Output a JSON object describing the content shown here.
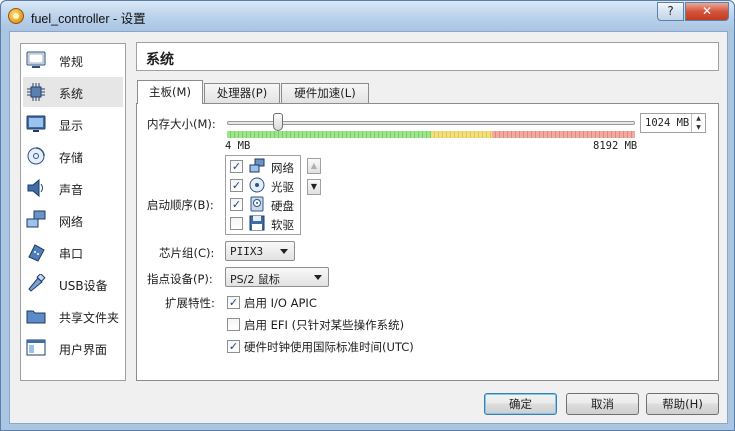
{
  "window": {
    "title": "fuel_controller - 设置",
    "help_label": "?",
    "close_label": "✕"
  },
  "sidebar": {
    "items": [
      {
        "label": "常规",
        "icon": "monitor-general-icon"
      },
      {
        "label": "系统",
        "icon": "chip-icon"
      },
      {
        "label": "显示",
        "icon": "display-icon"
      },
      {
        "label": "存储",
        "icon": "storage-disk-icon"
      },
      {
        "label": "声音",
        "icon": "speaker-icon"
      },
      {
        "label": "网络",
        "icon": "network-icon"
      },
      {
        "label": "串口",
        "icon": "serial-port-icon"
      },
      {
        "label": "USB设备",
        "icon": "usb-icon"
      },
      {
        "label": "共享文件夹",
        "icon": "folder-icon"
      },
      {
        "label": "用户界面",
        "icon": "user-interface-icon"
      }
    ],
    "selected": "系统"
  },
  "page": {
    "title": "系统"
  },
  "tabs": [
    {
      "label": "主板(M)",
      "active": true
    },
    {
      "label": "处理器(P)",
      "active": false
    },
    {
      "label": "硬件加速(L)",
      "active": false
    }
  ],
  "motherboard": {
    "memory_label": "内存大小(M):",
    "memory_value": "1024 MB",
    "memory_fraction": 0.124,
    "memory_min_label": "4 MB",
    "memory_max_label": "8192 MB",
    "boot_order_label": "启动顺序(B):",
    "boot_items": [
      {
        "label": "网络",
        "checked": true,
        "icon": "network-icon"
      },
      {
        "label": "光驱",
        "checked": true,
        "icon": "optical-drive-icon"
      },
      {
        "label": "硬盘",
        "checked": true,
        "icon": "hard-disk-icon"
      },
      {
        "label": "软驱",
        "checked": false,
        "icon": "floppy-icon"
      }
    ],
    "move_up_icon": "arrow-up-icon",
    "move_down_icon": "arrow-down-icon",
    "chipset_label": "芯片组(C):",
    "chipset_value": "PIIX3",
    "pointing_label": "指点设备(P):",
    "pointing_value": "PS/2 鼠标",
    "features_label": "扩展特性:",
    "features": [
      {
        "label": "启用 I/O APIC",
        "checked": true
      },
      {
        "label": "启用 EFI (只针对某些操作系统)",
        "checked": false
      },
      {
        "label": "硬件时钟使用国际标准时间(UTC)",
        "checked": true
      }
    ]
  },
  "buttons": {
    "ok": "确定",
    "cancel": "取消",
    "help": "帮助(H)"
  }
}
